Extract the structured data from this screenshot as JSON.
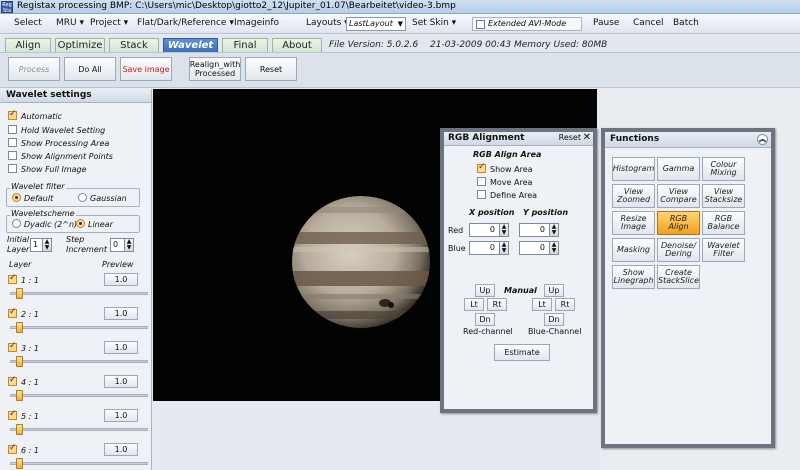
{
  "titlebar": {
    "icon": "Reg Sta",
    "title": "Registax processing BMP: C:\\Users\\mic\\Desktop\\giotto2_12\\Jupiter_01.07\\Bearbeitet\\video-3.bmp"
  },
  "menu": {
    "select": "Select",
    "mru": "MRU ▾",
    "project": "Project ▾",
    "flat": "Flat/Dark/Reference ▾",
    "imageinfo": "Imageinfo",
    "layouts": "Layouts ▾",
    "layout_value": "LastLayout",
    "setskin": "Set Skin ▾",
    "extended_avi": "Extended AVI-Mode",
    "pause": "Pause",
    "cancel": "Cancel",
    "batch": "Batch"
  },
  "tabs": [
    "Align",
    "Optimize",
    "Stack",
    "Wavelet",
    "Final",
    "About"
  ],
  "active_tab": "Wavelet",
  "fileinfo": {
    "version": "File Version: 5.0.2.6",
    "datetime": "21-03-2009 00:43",
    "memory": "Memory Used: 80MB"
  },
  "toolbar": {
    "process": "Process",
    "doall": "Do All",
    "saveimage": "Save image",
    "realign1": "Realign_with",
    "realign2": "Processed",
    "reset": "Reset"
  },
  "wavelet": {
    "title": "Wavelet settings",
    "automatic": "Automatic",
    "hold": "Hold Wavelet Setting",
    "show_processing": "Show Processing Area",
    "show_alignment": "Show Alignment Points",
    "show_full": "Show Full Image",
    "filter_label": "Wavelet filter",
    "default": "Default",
    "gaussian": "Gaussian",
    "scheme_label": "Waveletscheme",
    "dyadic": "Dyadic (2^n)",
    "linear": "Linear",
    "initial1": "Initial",
    "initial2": "Layer",
    "initial_value": "1",
    "step1": "Step",
    "step2": "Increment",
    "step_value": "0",
    "layer_label": "Layer",
    "preview_label": "Preview",
    "layers": [
      {
        "label": "1 : 1",
        "preview": "1.0"
      },
      {
        "label": "2 : 1",
        "preview": "1.0"
      },
      {
        "label": "3 : 1",
        "preview": "1.0"
      },
      {
        "label": "4 : 1",
        "preview": "1.0"
      },
      {
        "label": "5 : 1",
        "preview": "1.0"
      },
      {
        "label": "6 : 1",
        "preview": "1.0"
      }
    ]
  },
  "rgb": {
    "title": "RGB Alignment",
    "reset": "Reset",
    "close": "✕",
    "area_label": "RGB Align Area",
    "show_area": "Show Area",
    "move_area": "Move Area",
    "define_area": "Define Area",
    "xpos": "X position",
    "ypos": "Y position",
    "red": "Red",
    "blue": "Blue",
    "red_x": "0",
    "red_y": "0",
    "blue_x": "0",
    "blue_y": "0",
    "manual": "Manual",
    "up": "Up",
    "lt": "Lt",
    "rt": "Rt",
    "dn": "Dn",
    "red_channel": "Red-channel",
    "blue_channel": "Blue-Channel",
    "estimate": "Estimate"
  },
  "functions": {
    "title": "Functions",
    "buttons": [
      {
        "l1": "Histogram",
        "l2": ""
      },
      {
        "l1": "Gamma",
        "l2": ""
      },
      {
        "l1": "Colour",
        "l2": "Mixing"
      },
      {
        "l1": "View",
        "l2": "Zoomed"
      },
      {
        "l1": "View",
        "l2": "Compare"
      },
      {
        "l1": "View",
        "l2": "Stacksize"
      },
      {
        "l1": "Resize",
        "l2": "Image"
      },
      {
        "l1": "RGB",
        "l2": "Align"
      },
      {
        "l1": "RGB",
        "l2": "Balance"
      },
      {
        "l1": "Masking",
        "l2": ""
      },
      {
        "l1": "Denoise/",
        "l2": "Dering"
      },
      {
        "l1": "Wavelet",
        "l2": "Filter"
      },
      {
        "l1": "Show",
        "l2": "Linegraph"
      },
      {
        "l1": "Create",
        "l2": "StackSlice"
      }
    ]
  },
  "colors": {
    "active_tab": "#4a7cc4",
    "accent_orange": "#f3a021",
    "save_red": "#d01818"
  }
}
